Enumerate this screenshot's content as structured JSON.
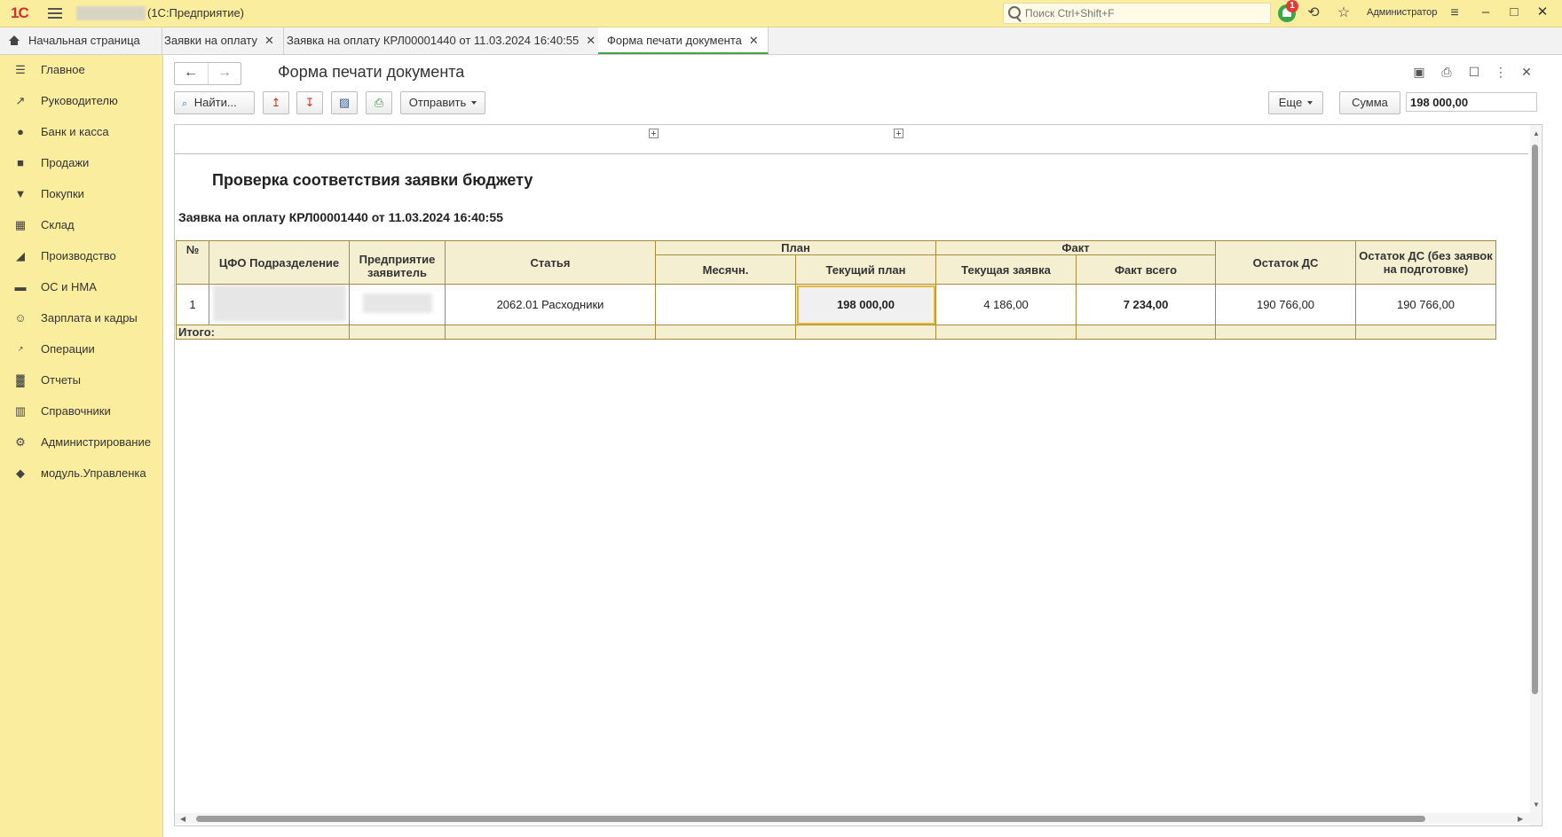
{
  "app": {
    "logo": "1С",
    "title": "(1С:Предприятие)",
    "search_placeholder": "Поиск Ctrl+Shift+F",
    "notifications_count": "1",
    "user": "Администратор"
  },
  "tabs": [
    {
      "label": "Начальная страница"
    },
    {
      "label": "Заявки на оплату"
    },
    {
      "label": "Заявка на оплату КРЛ00001440 от 11.03.2024 16:40:55"
    },
    {
      "label": "Форма печати документа"
    }
  ],
  "sidebar": {
    "items": [
      {
        "label": "Главное",
        "icon": "menu-icon"
      },
      {
        "label": "Руководителю",
        "icon": "trend-icon"
      },
      {
        "label": "Банк и касса",
        "icon": "coin-icon"
      },
      {
        "label": "Продажи",
        "icon": "bag-icon"
      },
      {
        "label": "Покупки",
        "icon": "cart-icon"
      },
      {
        "label": "Склад",
        "icon": "warehouse-icon"
      },
      {
        "label": "Производство",
        "icon": "factory-icon"
      },
      {
        "label": "ОС и НМА",
        "icon": "truck-icon"
      },
      {
        "label": "Зарплата и кадры",
        "icon": "person-icon"
      },
      {
        "label": "Операции",
        "icon": "dt-kt-icon"
      },
      {
        "label": "Отчеты",
        "icon": "bar-chart-icon"
      },
      {
        "label": "Справочники",
        "icon": "books-icon"
      },
      {
        "label": "Администрирование",
        "icon": "gear-icon"
      },
      {
        "label": "модуль.Управленка",
        "icon": "cube-icon"
      }
    ]
  },
  "form": {
    "title": "Форма печати документа",
    "toolbar": {
      "find_label": "Найти...",
      "send_label": "Отправить",
      "more_label": "Еще",
      "sum_label": "Сумма",
      "sum_value": "198 000,00"
    }
  },
  "report": {
    "title": "Проверка соответствия заявки бюджету",
    "subtitle": "Заявка на оплату КРЛ00001440 от 11.03.2024 16:40:55",
    "headers": {
      "num": "№",
      "cfo": "ЦФО Подразделение",
      "enterprise": "Предприятие заявитель",
      "article": "Статья",
      "plan": "План",
      "plan_monthly": "Месячн.",
      "plan_current": "Текущий план",
      "fact": "Факт",
      "fact_current": "Текущая заявка",
      "fact_total": "Факт всего",
      "balance": "Остаток ДС",
      "balance_no_drafts": "Остаток ДС (без заявок на подготовке)"
    },
    "row": {
      "num": "1",
      "article": "2062.01  Расходники",
      "plan_monthly": "",
      "plan_current": "198 000,00",
      "fact_current": "4 186,00",
      "fact_total": "7 234,00",
      "balance": "190 766,00",
      "balance_no_drafts": "190 766,00"
    },
    "total_label": "Итого:"
  }
}
